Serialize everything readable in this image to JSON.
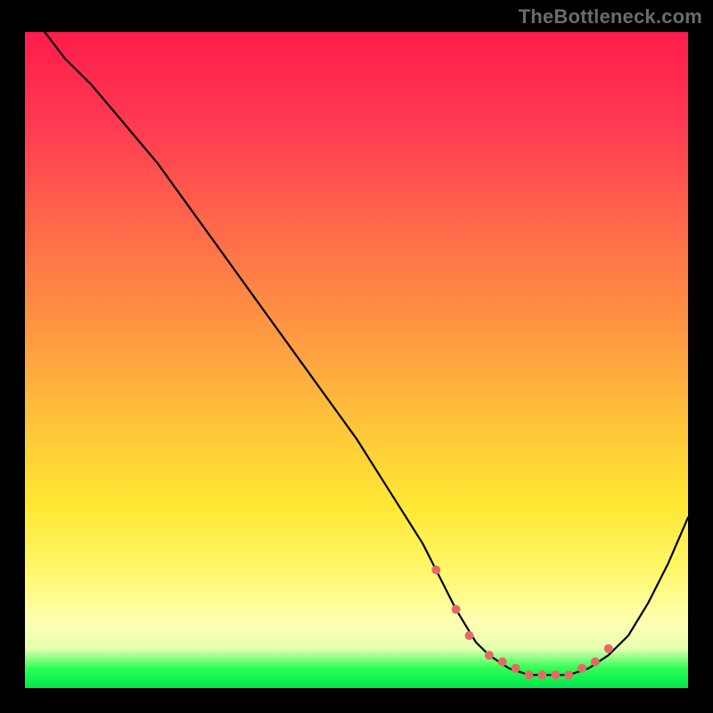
{
  "attribution": "TheBottleneck.com",
  "colors": {
    "page_bg": "#000000",
    "attribution_text": "#6b6b6b",
    "curve_stroke": "#000000",
    "dot_fill": "#e46a66",
    "gradient_stops": [
      "#ff1c4b",
      "#ff3a52",
      "#ff6a4a",
      "#ff9942",
      "#ffc53a",
      "#ffe733",
      "#fff86a",
      "#ffffb3",
      "#e5ffb0",
      "#2eff54",
      "#00e64a"
    ]
  },
  "chart_data": {
    "type": "line",
    "title": "",
    "xlabel": "",
    "ylabel": "",
    "xlim": [
      0,
      100
    ],
    "ylim": [
      0,
      100
    ],
    "series": [
      {
        "name": "bottleneck-curve",
        "x": [
          3,
          6,
          10,
          15,
          20,
          25,
          30,
          35,
          40,
          45,
          50,
          55,
          60,
          62,
          65,
          68,
          70,
          73,
          76,
          79,
          82,
          85,
          88,
          91,
          94,
          97,
          100
        ],
        "y": [
          100,
          96,
          92,
          86,
          80,
          73,
          66,
          59,
          52,
          45,
          38,
          30,
          22,
          18,
          12,
          7,
          5,
          3,
          2,
          2,
          2,
          3,
          5,
          8,
          13,
          19,
          26
        ]
      }
    ],
    "markers": {
      "name": "optimal-range-dots",
      "x": [
        62,
        65,
        67,
        70,
        72,
        74,
        76,
        78,
        80,
        82,
        84,
        86,
        88
      ],
      "y": [
        18,
        12,
        8,
        5,
        4,
        3,
        2,
        2,
        2,
        2,
        3,
        4,
        6
      ]
    }
  }
}
